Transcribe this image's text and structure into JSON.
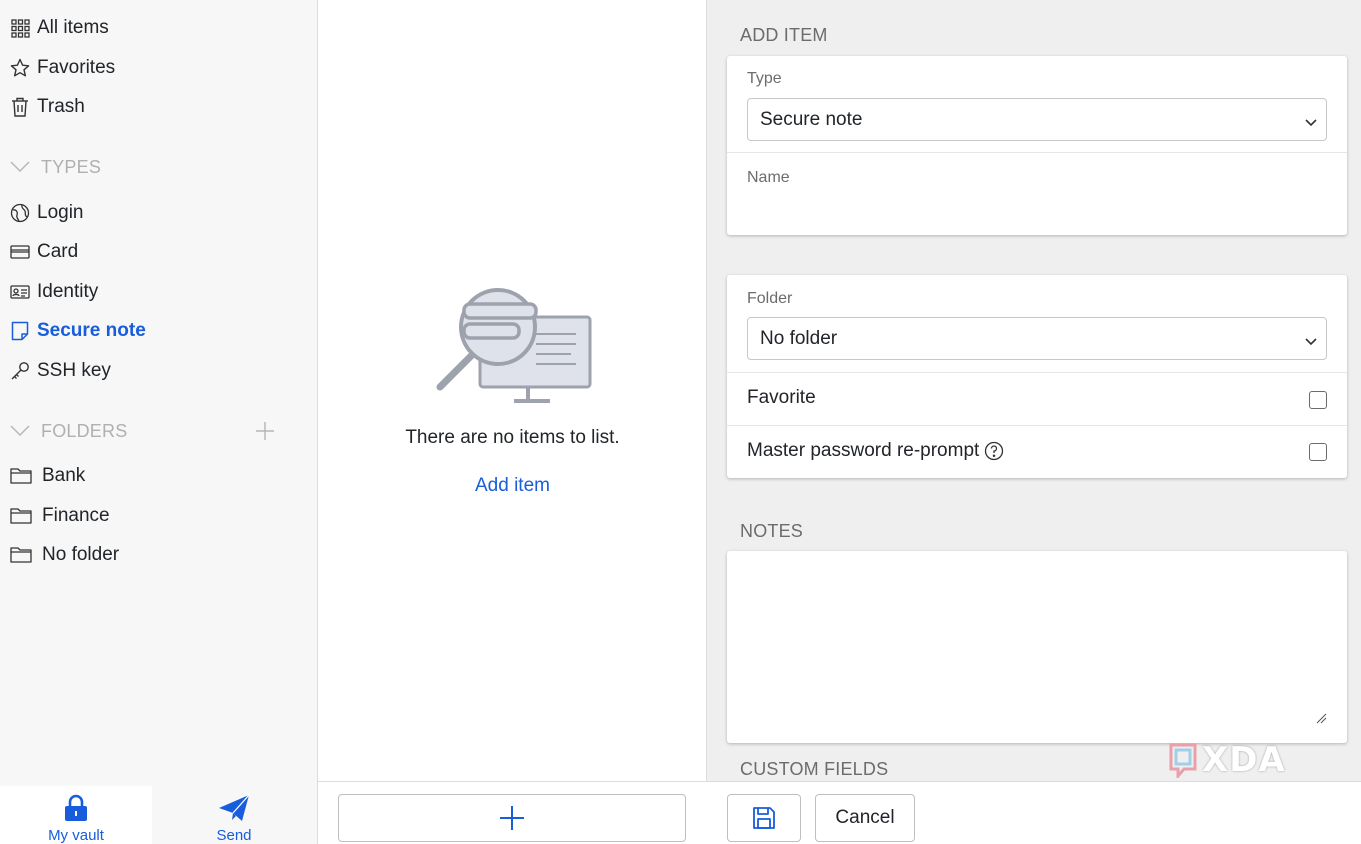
{
  "sidebar": {
    "top_items": [
      {
        "label": "All items",
        "icon": "grid-icon"
      },
      {
        "label": "Favorites",
        "icon": "star-icon"
      },
      {
        "label": "Trash",
        "icon": "trash-icon"
      }
    ],
    "types_heading": "TYPES",
    "types": [
      {
        "label": "Login",
        "icon": "globe-icon"
      },
      {
        "label": "Card",
        "icon": "credit-card-icon"
      },
      {
        "label": "Identity",
        "icon": "id-card-icon"
      },
      {
        "label": "Secure note",
        "icon": "sticky-note-icon",
        "active": true
      },
      {
        "label": "SSH key",
        "icon": "key-icon"
      }
    ],
    "folders_heading": "FOLDERS",
    "folders": [
      {
        "label": "Bank",
        "icon": "folder-icon"
      },
      {
        "label": "Finance",
        "icon": "folder-icon"
      },
      {
        "label": "No folder",
        "icon": "folder-icon"
      }
    ]
  },
  "bottom_nav": {
    "vault_label": "My vault",
    "send_label": "Send"
  },
  "list": {
    "empty_text": "There are no items to list.",
    "add_item_label": "Add item"
  },
  "form": {
    "section_title": "ADD ITEM",
    "type_label": "Type",
    "type_value": "Secure note",
    "name_label": "Name",
    "name_value": "",
    "folder_label": "Folder",
    "folder_value": "No folder",
    "favorite_label": "Favorite",
    "favorite_checked": false,
    "reprompt_label": "Master password re-prompt",
    "reprompt_checked": false,
    "notes_title": "NOTES",
    "notes_value": "",
    "custom_fields_title": "CUSTOM FIELDS",
    "cancel_label": "Cancel"
  },
  "colors": {
    "accent": "#175ddc",
    "sidebar_bg": "#f7f7f7",
    "detail_bg": "#efefef"
  },
  "watermark": "XDA"
}
